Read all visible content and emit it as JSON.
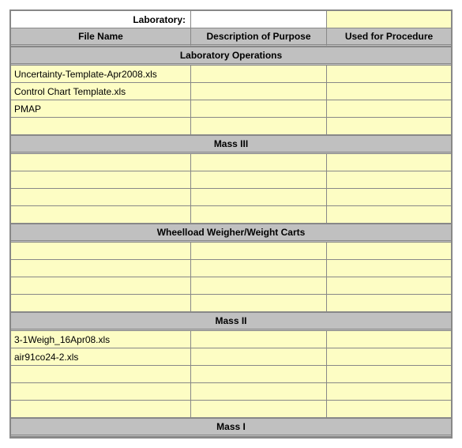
{
  "labels": {
    "laboratory": "Laboratory:",
    "file_name": "File Name",
    "description": "Description of Purpose",
    "used_for": "Used for Procedure"
  },
  "laboratory_value": "",
  "sections": [
    {
      "title": "Laboratory Operations",
      "rows": [
        {
          "file": "Uncertainty-Template-Apr2008.xls",
          "desc": "",
          "proc": ""
        },
        {
          "file": "Control Chart Template.xls",
          "desc": "",
          "proc": ""
        },
        {
          "file": "PMAP",
          "desc": "",
          "proc": ""
        },
        {
          "file": "",
          "desc": "",
          "proc": ""
        }
      ]
    },
    {
      "title": "Mass III",
      "rows": [
        {
          "file": "",
          "desc": "",
          "proc": ""
        },
        {
          "file": "",
          "desc": "",
          "proc": ""
        },
        {
          "file": "",
          "desc": "",
          "proc": ""
        },
        {
          "file": "",
          "desc": "",
          "proc": ""
        }
      ]
    },
    {
      "title": "Wheelload Weigher/Weight Carts",
      "rows": [
        {
          "file": "",
          "desc": "",
          "proc": ""
        },
        {
          "file": "",
          "desc": "",
          "proc": ""
        },
        {
          "file": "",
          "desc": "",
          "proc": ""
        },
        {
          "file": "",
          "desc": "",
          "proc": ""
        }
      ]
    },
    {
      "title": "Mass II",
      "rows": [
        {
          "file": "3-1Weigh_16Apr08.xls",
          "desc": "",
          "proc": ""
        },
        {
          "file": "air91co24-2.xls",
          "desc": "",
          "proc": ""
        },
        {
          "file": "",
          "desc": "",
          "proc": ""
        },
        {
          "file": "",
          "desc": "",
          "proc": ""
        },
        {
          "file": "",
          "desc": "",
          "proc": ""
        }
      ]
    },
    {
      "title": "Mass I",
      "rows": []
    }
  ]
}
